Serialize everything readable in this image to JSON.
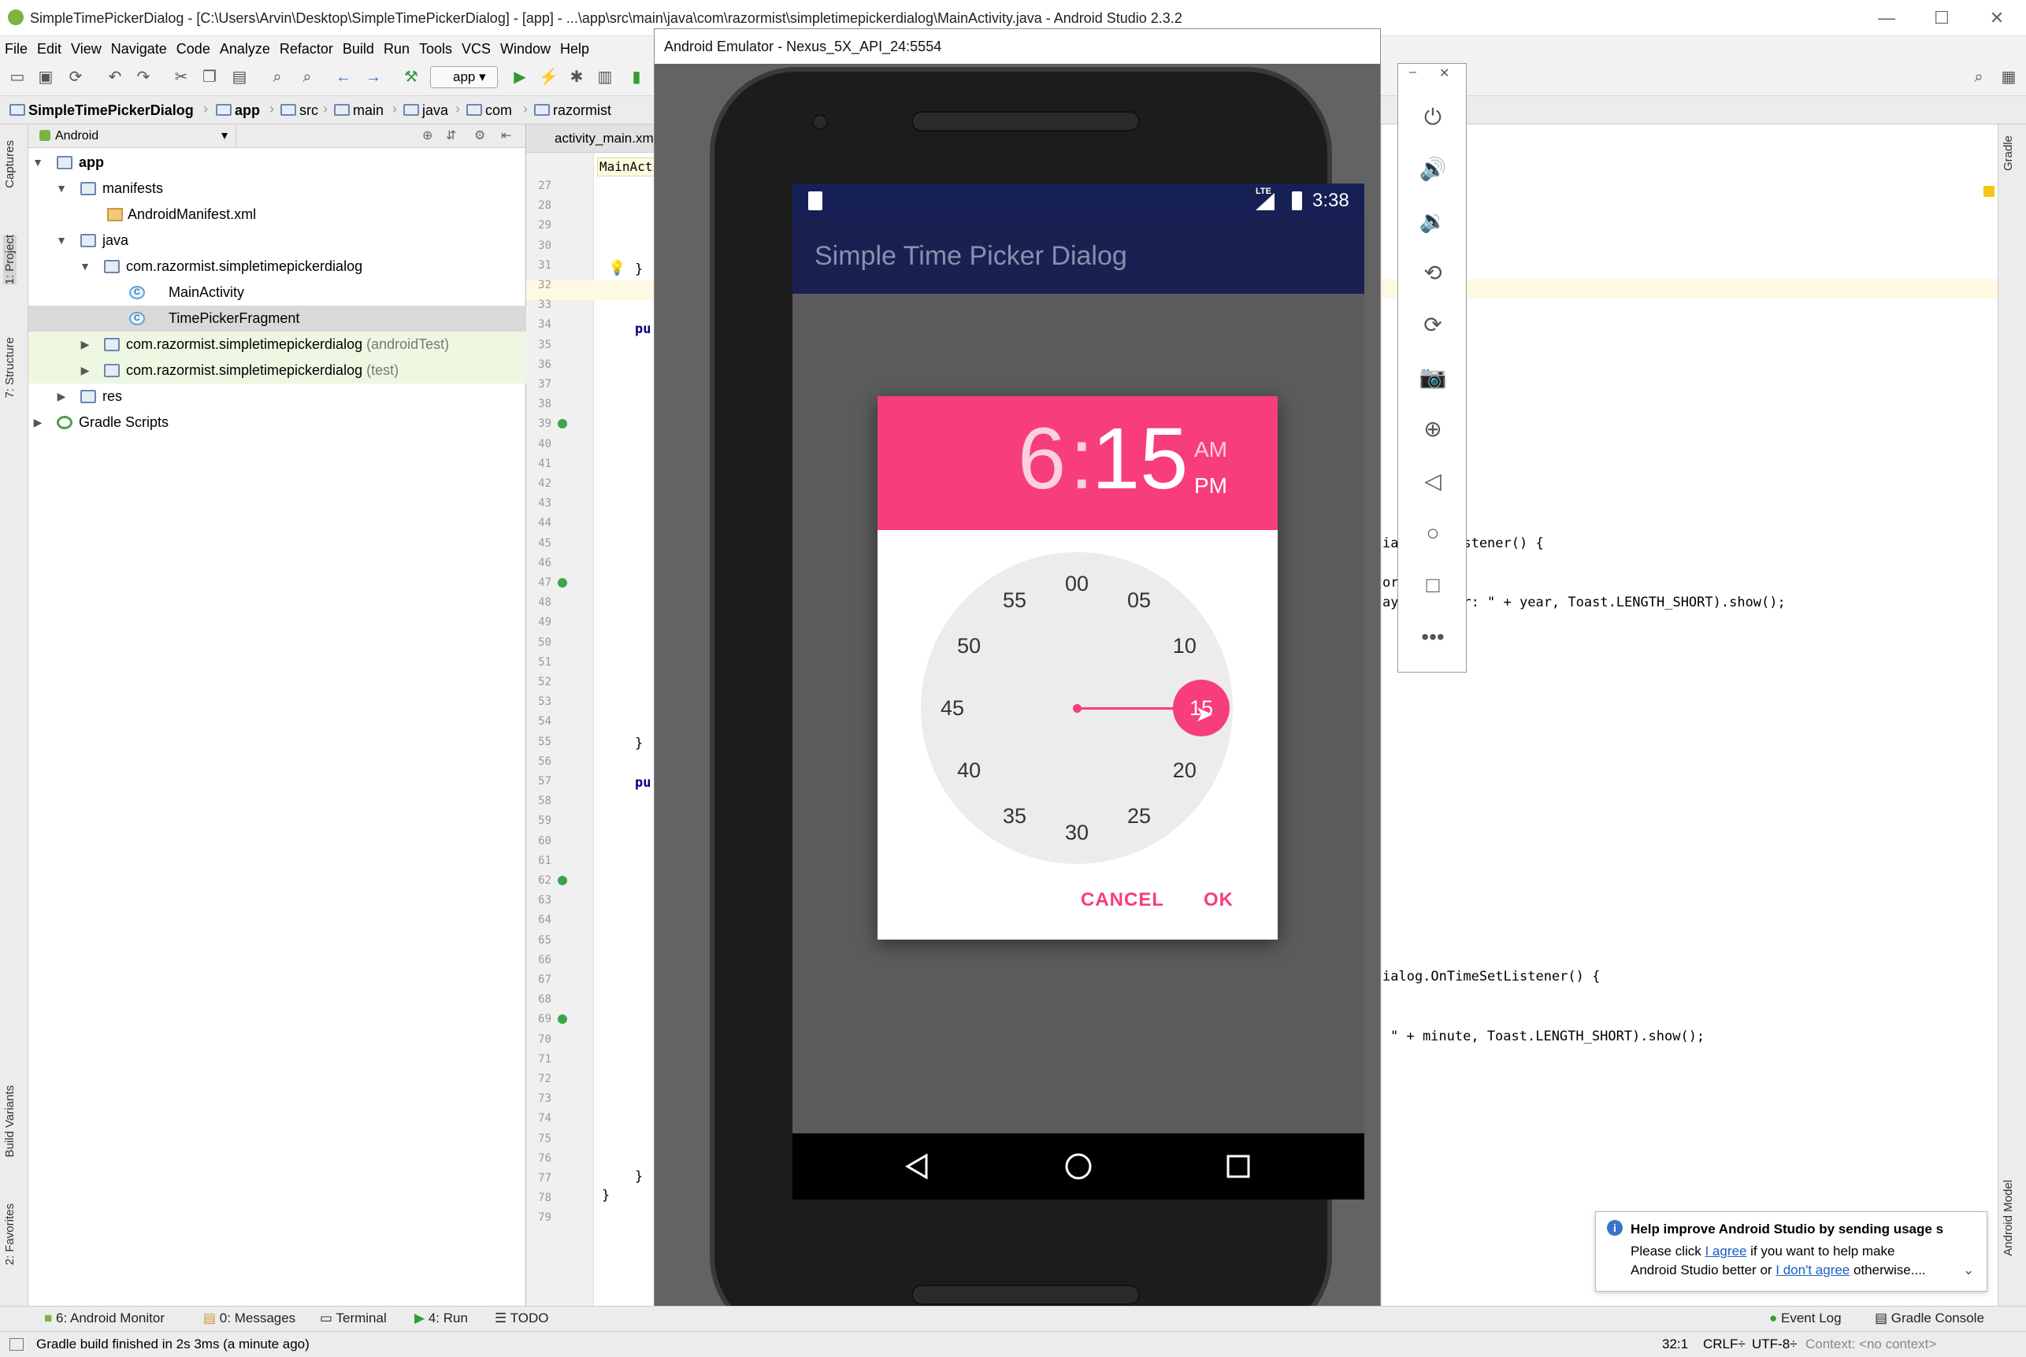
{
  "window": {
    "title": "SimpleTimePickerDialog - [C:\\Users\\Arvin\\Desktop\\SimpleTimePickerDialog] - [app] - ...\\app\\src\\main\\java\\com\\razormist\\simpletimepickerdialog\\MainActivity.java - Android Studio 2.3.2"
  },
  "menu": [
    "File",
    "Edit",
    "View",
    "Navigate",
    "Code",
    "Analyze",
    "Refactor",
    "Build",
    "Run",
    "Tools",
    "VCS",
    "Window",
    "Help"
  ],
  "toolbar": {
    "run_config": "app"
  },
  "breadcrumb": [
    "SimpleTimePickerDialog",
    "app",
    "src",
    "main",
    "java",
    "com",
    "razormist"
  ],
  "project": {
    "view_mode": "Android",
    "tree": [
      {
        "label": "app",
        "bold": true
      },
      {
        "label": "manifests"
      },
      {
        "label": "AndroidManifest.xml"
      },
      {
        "label": "java"
      },
      {
        "label": "com.razormist.simpletimepickerdialog"
      },
      {
        "label": "MainActivity"
      },
      {
        "label": "TimePickerFragment"
      },
      {
        "label": "com.razormist.simpletimepickerdialog",
        "suffix": "(androidTest)"
      },
      {
        "label": "com.razormist.simpletimepickerdialog",
        "suffix": "(test)"
      },
      {
        "label": "res"
      },
      {
        "label": "Gradle Scripts"
      }
    ]
  },
  "side_tabs": {
    "left": [
      "1: Project",
      "7: Structure",
      "Captures",
      "Build Variants",
      "2: Favorites"
    ],
    "right": [
      "Gradle",
      "Android Model"
    ]
  },
  "editor": {
    "tabs": [
      "activity_main.xml",
      "MainActivity"
    ],
    "line_numbers": [
      "27",
      "28",
      "29",
      "30",
      "31",
      "32",
      "33",
      "34",
      "35",
      "36",
      "37",
      "38",
      "39",
      "40",
      "41",
      "42",
      "43",
      "44",
      "45",
      "46",
      "47",
      "48",
      "49",
      "50",
      "51",
      "52",
      "53",
      "54",
      "55",
      "56",
      "57",
      "58",
      "59",
      "60",
      "61",
      "62",
      "63",
      "64",
      "65",
      "66",
      "67",
      "68",
      "69",
      "70",
      "71",
      "72",
      "73",
      "74",
      "75",
      "76",
      "77",
      "78",
      "79"
    ],
    "snippets": {
      "brace1": "}",
      "pub1": "pu",
      "brace2": "}",
      "pub2": "pu",
      "brace3": "}",
      "brace4": "}",
      "r1": "ia          teSetListener() {",
      "r2": "or",
      "r3": "ay          + \" Year: \" + year, Toast.LENGTH_SHORT).show();",
      "r4": "ialog.OnTimeSetListener() {",
      "r5": "\" + minute, Toast.LENGTH_SHORT).show();"
    }
  },
  "emulator": {
    "title": "Android Emulator - Nexus_5X_API_24:5554",
    "status_time": "3:38",
    "status_net": "LTE",
    "app_title": "Simple Time Picker Dialog",
    "time_picker": {
      "hour": "6",
      "minute": "15",
      "separator": ":",
      "am": "AM",
      "pm": "PM",
      "selected_period": "PM",
      "selected_minute": 15,
      "dial": [
        "00",
        "05",
        "10",
        "15",
        "20",
        "25",
        "30",
        "35",
        "40",
        "45",
        "50",
        "55"
      ],
      "cancel": "CANCEL",
      "ok": "OK"
    },
    "controls": [
      "power",
      "volume-up",
      "volume-down",
      "rotate-left",
      "rotate-right",
      "camera",
      "zoom",
      "back",
      "home",
      "overview",
      "more"
    ]
  },
  "bottom_tools": [
    "6: Android Monitor",
    "0: Messages",
    "Terminal",
    "4: Run",
    "TODO"
  ],
  "bottom_tools_right": [
    "Event Log",
    "Gradle Console"
  ],
  "status": {
    "message": "Gradle build finished in 2s 3ms (a minute ago)",
    "position": "32:1",
    "line_sep": "CRLF÷",
    "encoding": "UTF-8÷",
    "context": "Context: <no context>"
  },
  "notification": {
    "title": "Help improve Android Studio by sending usage s",
    "line1_pre": "Please click ",
    "agree": "I agree",
    "line1_post": " if you want to help make",
    "line2_pre": "Android Studio better or ",
    "disagree": "I don't agree",
    "line2_post": " otherwise...."
  },
  "colors": {
    "accent": "#f73d7b",
    "app_bar": "#1a2150"
  }
}
